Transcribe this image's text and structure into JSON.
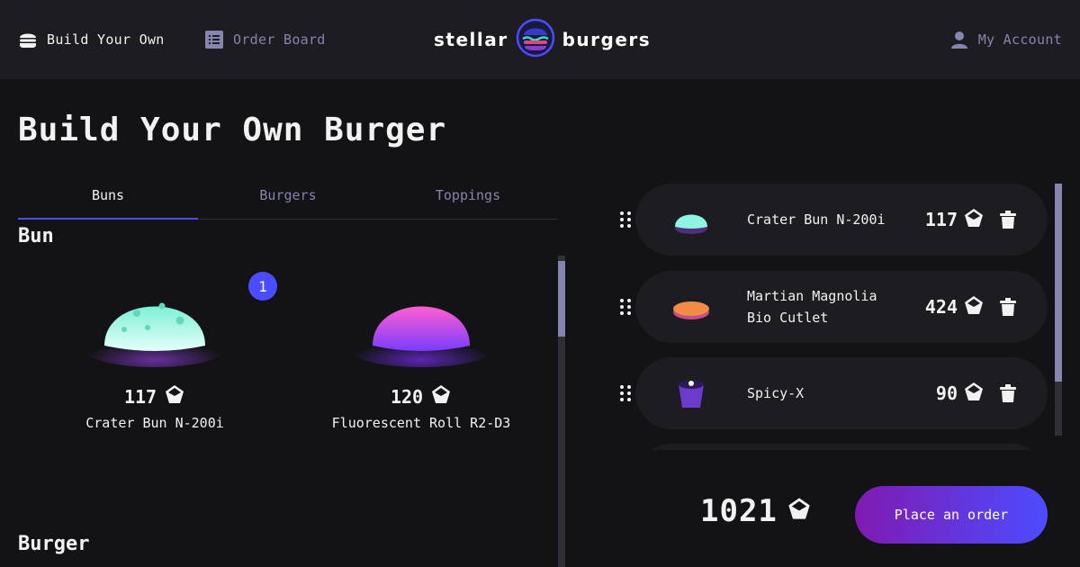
{
  "header": {
    "nav": {
      "build_label": "Build Your Own",
      "orders_label": "Order Board",
      "account_label": "My Account"
    },
    "logo": {
      "left_word": "stellar",
      "right_word": "burgers"
    }
  },
  "main": {
    "title": "Build Your Own Burger",
    "tabs": [
      {
        "label": "Buns",
        "active": true
      },
      {
        "label": "Burgers",
        "active": false
      },
      {
        "label": "Toppings",
        "active": false
      }
    ],
    "sections": {
      "bun": "Bun",
      "burger": "Burger"
    },
    "buns": [
      {
        "name": "Crater Bun N-200i",
        "price": "117",
        "count": "1",
        "color": "#8ef5e2",
        "icon": "crater-bun-image"
      },
      {
        "name": "Fluorescent Roll R2-D3",
        "price": "120",
        "color": "#d14bd6",
        "icon": "fluorescent-roll-image"
      }
    ]
  },
  "constructor": {
    "items": [
      {
        "name": "Crater Bun N-200i",
        "price": "117",
        "icon": "crater-bun-image"
      },
      {
        "name": "Martian Magnolia Bio Cutlet",
        "price": "424",
        "icon": "cutlet-image"
      },
      {
        "name": "Spicy-X",
        "price": "90",
        "icon": "sauce-image"
      }
    ],
    "total": "1021",
    "order_button": "Place an order"
  },
  "colors": {
    "accent": "#4c4cff",
    "accent_gradient_start": "#801ab2",
    "muted_text": "#8585ad",
    "panel": "#1c1c21",
    "background": "#131316"
  }
}
